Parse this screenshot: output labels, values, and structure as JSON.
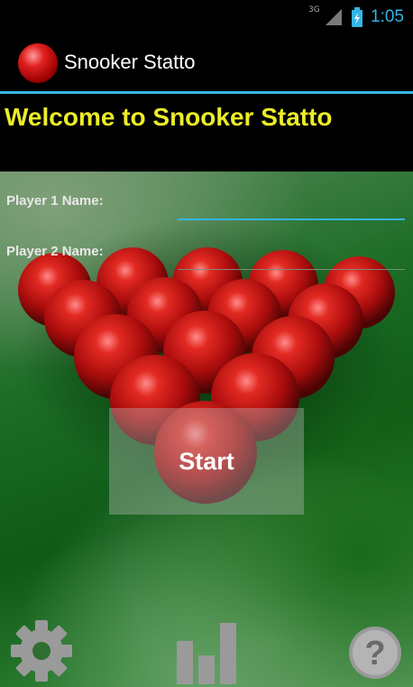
{
  "status_bar": {
    "network": "3G",
    "time": "1:05"
  },
  "action_bar": {
    "title": "Snooker Statto",
    "logo_icon": "snooker-ball-icon"
  },
  "welcome": {
    "text": "Welcome to Snooker Statto"
  },
  "form": {
    "player1_label": "Player 1 Name:",
    "player1_value": "",
    "player2_label": "Player 2 Name:",
    "player2_value": ""
  },
  "start_button": {
    "label": "Start"
  },
  "bottom_icons": {
    "settings": "gear-icon",
    "stats": "bar-chart-icon",
    "help": "help-icon"
  },
  "colors": {
    "accent": "#33b5e5",
    "welcome_text": "#ecec28",
    "ball_red": "#c81818",
    "input_active": "#33b5e5",
    "input_inactive": "#7a8a7a"
  }
}
